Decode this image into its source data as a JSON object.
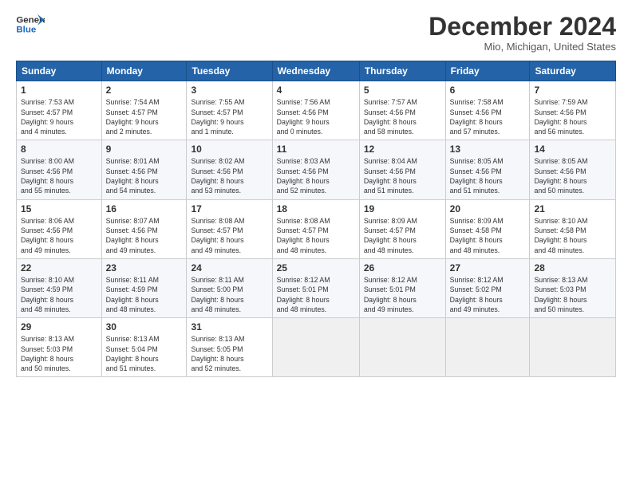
{
  "header": {
    "logo_line1": "General",
    "logo_line2": "Blue",
    "month_title": "December 2024",
    "location": "Mio, Michigan, United States"
  },
  "days_of_week": [
    "Sunday",
    "Monday",
    "Tuesday",
    "Wednesday",
    "Thursday",
    "Friday",
    "Saturday"
  ],
  "weeks": [
    [
      {
        "day": "1",
        "info": "Sunrise: 7:53 AM\nSunset: 4:57 PM\nDaylight: 9 hours\nand 4 minutes."
      },
      {
        "day": "2",
        "info": "Sunrise: 7:54 AM\nSunset: 4:57 PM\nDaylight: 9 hours\nand 2 minutes."
      },
      {
        "day": "3",
        "info": "Sunrise: 7:55 AM\nSunset: 4:57 PM\nDaylight: 9 hours\nand 1 minute."
      },
      {
        "day": "4",
        "info": "Sunrise: 7:56 AM\nSunset: 4:56 PM\nDaylight: 9 hours\nand 0 minutes."
      },
      {
        "day": "5",
        "info": "Sunrise: 7:57 AM\nSunset: 4:56 PM\nDaylight: 8 hours\nand 58 minutes."
      },
      {
        "day": "6",
        "info": "Sunrise: 7:58 AM\nSunset: 4:56 PM\nDaylight: 8 hours\nand 57 minutes."
      },
      {
        "day": "7",
        "info": "Sunrise: 7:59 AM\nSunset: 4:56 PM\nDaylight: 8 hours\nand 56 minutes."
      }
    ],
    [
      {
        "day": "8",
        "info": "Sunrise: 8:00 AM\nSunset: 4:56 PM\nDaylight: 8 hours\nand 55 minutes."
      },
      {
        "day": "9",
        "info": "Sunrise: 8:01 AM\nSunset: 4:56 PM\nDaylight: 8 hours\nand 54 minutes."
      },
      {
        "day": "10",
        "info": "Sunrise: 8:02 AM\nSunset: 4:56 PM\nDaylight: 8 hours\nand 53 minutes."
      },
      {
        "day": "11",
        "info": "Sunrise: 8:03 AM\nSunset: 4:56 PM\nDaylight: 8 hours\nand 52 minutes."
      },
      {
        "day": "12",
        "info": "Sunrise: 8:04 AM\nSunset: 4:56 PM\nDaylight: 8 hours\nand 51 minutes."
      },
      {
        "day": "13",
        "info": "Sunrise: 8:05 AM\nSunset: 4:56 PM\nDaylight: 8 hours\nand 51 minutes."
      },
      {
        "day": "14",
        "info": "Sunrise: 8:05 AM\nSunset: 4:56 PM\nDaylight: 8 hours\nand 50 minutes."
      }
    ],
    [
      {
        "day": "15",
        "info": "Sunrise: 8:06 AM\nSunset: 4:56 PM\nDaylight: 8 hours\nand 49 minutes."
      },
      {
        "day": "16",
        "info": "Sunrise: 8:07 AM\nSunset: 4:56 PM\nDaylight: 8 hours\nand 49 minutes."
      },
      {
        "day": "17",
        "info": "Sunrise: 8:08 AM\nSunset: 4:57 PM\nDaylight: 8 hours\nand 49 minutes."
      },
      {
        "day": "18",
        "info": "Sunrise: 8:08 AM\nSunset: 4:57 PM\nDaylight: 8 hours\nand 48 minutes."
      },
      {
        "day": "19",
        "info": "Sunrise: 8:09 AM\nSunset: 4:57 PM\nDaylight: 8 hours\nand 48 minutes."
      },
      {
        "day": "20",
        "info": "Sunrise: 8:09 AM\nSunset: 4:58 PM\nDaylight: 8 hours\nand 48 minutes."
      },
      {
        "day": "21",
        "info": "Sunrise: 8:10 AM\nSunset: 4:58 PM\nDaylight: 8 hours\nand 48 minutes."
      }
    ],
    [
      {
        "day": "22",
        "info": "Sunrise: 8:10 AM\nSunset: 4:59 PM\nDaylight: 8 hours\nand 48 minutes."
      },
      {
        "day": "23",
        "info": "Sunrise: 8:11 AM\nSunset: 4:59 PM\nDaylight: 8 hours\nand 48 minutes."
      },
      {
        "day": "24",
        "info": "Sunrise: 8:11 AM\nSunset: 5:00 PM\nDaylight: 8 hours\nand 48 minutes."
      },
      {
        "day": "25",
        "info": "Sunrise: 8:12 AM\nSunset: 5:01 PM\nDaylight: 8 hours\nand 48 minutes."
      },
      {
        "day": "26",
        "info": "Sunrise: 8:12 AM\nSunset: 5:01 PM\nDaylight: 8 hours\nand 49 minutes."
      },
      {
        "day": "27",
        "info": "Sunrise: 8:12 AM\nSunset: 5:02 PM\nDaylight: 8 hours\nand 49 minutes."
      },
      {
        "day": "28",
        "info": "Sunrise: 8:13 AM\nSunset: 5:03 PM\nDaylight: 8 hours\nand 50 minutes."
      }
    ],
    [
      {
        "day": "29",
        "info": "Sunrise: 8:13 AM\nSunset: 5:03 PM\nDaylight: 8 hours\nand 50 minutes."
      },
      {
        "day": "30",
        "info": "Sunrise: 8:13 AM\nSunset: 5:04 PM\nDaylight: 8 hours\nand 51 minutes."
      },
      {
        "day": "31",
        "info": "Sunrise: 8:13 AM\nSunset: 5:05 PM\nDaylight: 8 hours\nand 52 minutes."
      },
      {
        "day": "",
        "info": ""
      },
      {
        "day": "",
        "info": ""
      },
      {
        "day": "",
        "info": ""
      },
      {
        "day": "",
        "info": ""
      }
    ]
  ]
}
